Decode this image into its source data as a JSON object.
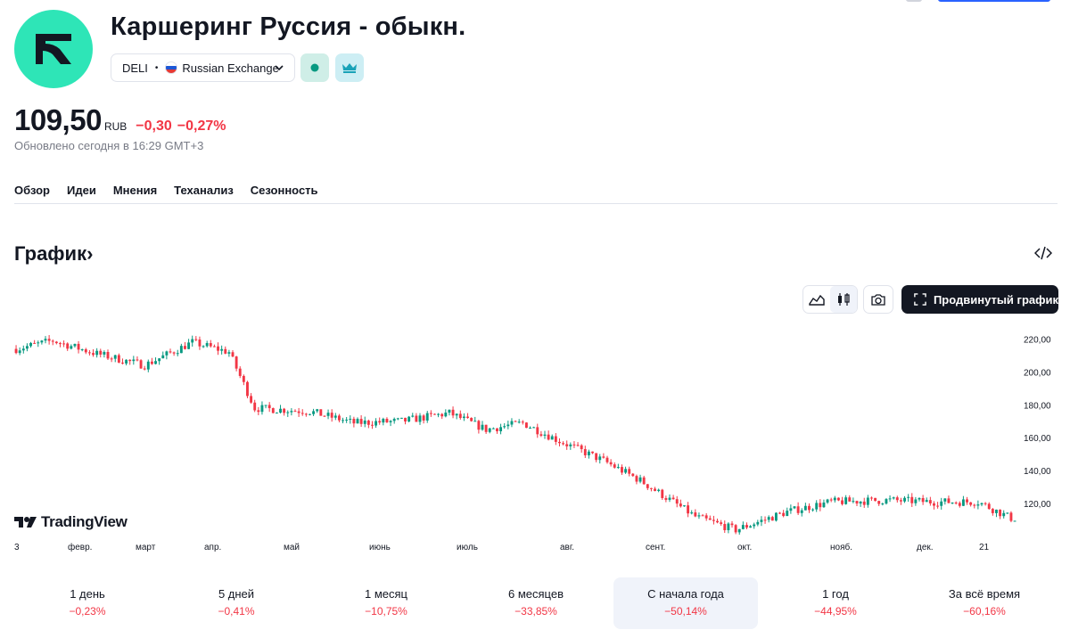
{
  "company": {
    "name": "Каршеринг Руссия - обыкн.",
    "ticker": "DELI",
    "exchange": "Russian Exchange"
  },
  "quote": {
    "price": "109,50",
    "currency": "RUB",
    "change": "−0,30",
    "change_pct": "−0,27%",
    "updated": "Обновлено сегодня в 16:29 GMT+3"
  },
  "tabs": [
    "Обзор",
    "Идеи",
    "Мнения",
    "Теханализ",
    "Сезонность"
  ],
  "active_tab": 0,
  "section": {
    "title": "График",
    "arrow": "›"
  },
  "toolbar": {
    "advanced_label": "Продвинутый график"
  },
  "branding": {
    "tv_text": "TradingView"
  },
  "colors": {
    "up": "#089981",
    "down": "#f23645",
    "logo_bg": "#2ee5b7",
    "text": "#131722",
    "muted": "#787b86"
  },
  "chart_data": {
    "type": "candlestick",
    "ylim": [
      100,
      230
    ],
    "y_ticks": [
      "220,00",
      "200,00",
      "180,00",
      "160,00",
      "140,00",
      "120,00"
    ],
    "y_tick_values": [
      220,
      200,
      180,
      160,
      140,
      120
    ],
    "x_labels": [
      "3",
      "февр.",
      "март",
      "апр.",
      "май",
      "июнь",
      "июль",
      "авг.",
      "сент.",
      "окт.",
      "нояб.",
      "дек.",
      "21"
    ],
    "trend": [
      [
        0,
        214
      ],
      [
        10,
        219
      ],
      [
        22,
        211
      ],
      [
        35,
        204
      ],
      [
        48,
        218
      ],
      [
        58,
        212
      ],
      [
        65,
        178
      ],
      [
        80,
        176
      ],
      [
        92,
        169
      ],
      [
        105,
        170
      ],
      [
        118,
        175
      ],
      [
        128,
        165
      ],
      [
        138,
        169
      ],
      [
        148,
        158
      ],
      [
        160,
        146
      ],
      [
        170,
        134
      ],
      [
        185,
        112
      ],
      [
        196,
        104
      ],
      [
        210,
        115
      ],
      [
        222,
        121
      ],
      [
        238,
        122
      ],
      [
        250,
        121
      ],
      [
        262,
        121
      ],
      [
        272,
        110
      ]
    ],
    "last": 109.5
  },
  "periods": [
    {
      "label": "1 день",
      "change": "−0,23%"
    },
    {
      "label": "5 дней",
      "change": "−0,41%"
    },
    {
      "label": "1 месяц",
      "change": "−10,75%"
    },
    {
      "label": "6 месяцев",
      "change": "−33,85%"
    },
    {
      "label": "С начала года",
      "change": "−50,14%"
    },
    {
      "label": "1 год",
      "change": "−44,95%"
    },
    {
      "label": "За всё время",
      "change": "−60,16%"
    }
  ],
  "active_period": 4
}
